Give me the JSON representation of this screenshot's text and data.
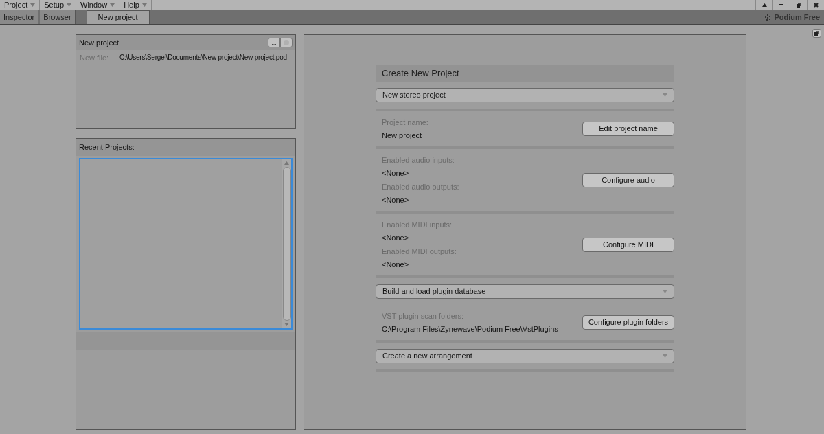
{
  "menu": [
    {
      "label": "Project"
    },
    {
      "label": "Setup"
    },
    {
      "label": "Window"
    },
    {
      "label": "Help"
    }
  ],
  "tabs": [
    {
      "label": "Inspector",
      "selected": false
    },
    {
      "label": "Browser",
      "selected": false
    },
    {
      "label": "New project",
      "selected": true
    }
  ],
  "brand": "Podium Free",
  "new_project_panel": {
    "title": "New project",
    "browse_button": "...",
    "file_label": "New file:",
    "file_path": "C:\\Users\\Sergei\\Documents\\New project\\New project.pod"
  },
  "recent_projects": {
    "title": "Recent Projects:"
  },
  "create_panel": {
    "title": "Create New Project",
    "sections": [
      {
        "kind": "dropdown",
        "value": "New stereo project",
        "divider_after": true
      },
      {
        "kind": "fields",
        "fields": [
          {
            "label": "Project name:",
            "value": "New project"
          }
        ],
        "button": "Edit project name",
        "divider_after": true
      },
      {
        "kind": "fields",
        "fields": [
          {
            "label": "Enabled audio inputs:",
            "value": "<None>"
          },
          {
            "label": "Enabled audio outputs:",
            "value": "<None>"
          }
        ],
        "button": "Configure audio",
        "divider_after": true
      },
      {
        "kind": "fields",
        "fields": [
          {
            "label": "Enabled MIDI inputs:",
            "value": "<None>"
          },
          {
            "label": "Enabled MIDI outputs:",
            "value": "<None>"
          }
        ],
        "button": "Configure MIDI",
        "divider_after": true
      },
      {
        "kind": "dropdown",
        "value": "Build and load plugin database",
        "divider_after": false
      },
      {
        "kind": "fields",
        "fields": [
          {
            "label": "VST plugin scan folders:",
            "value": "C:\\Program Files\\Zynewave\\Podium Free\\VstPlugins"
          }
        ],
        "button": "Configure plugin folders",
        "divider_after": true
      },
      {
        "kind": "dropdown",
        "value": "Create a new arrangement",
        "divider_after": true
      }
    ]
  }
}
